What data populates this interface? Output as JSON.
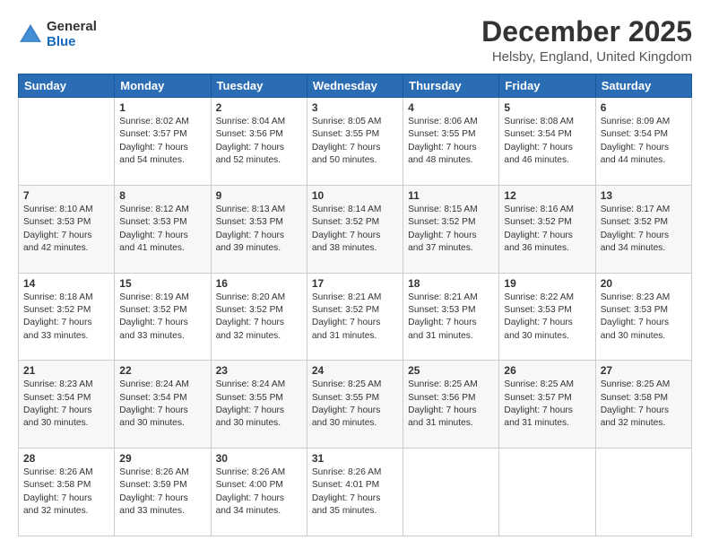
{
  "logo": {
    "general": "General",
    "blue": "Blue"
  },
  "title": "December 2025",
  "subtitle": "Helsby, England, United Kingdom",
  "days_of_week": [
    "Sunday",
    "Monday",
    "Tuesday",
    "Wednesday",
    "Thursday",
    "Friday",
    "Saturday"
  ],
  "weeks": [
    [
      {
        "day": "",
        "info": ""
      },
      {
        "day": "1",
        "info": "Sunrise: 8:02 AM\nSunset: 3:57 PM\nDaylight: 7 hours\nand 54 minutes."
      },
      {
        "day": "2",
        "info": "Sunrise: 8:04 AM\nSunset: 3:56 PM\nDaylight: 7 hours\nand 52 minutes."
      },
      {
        "day": "3",
        "info": "Sunrise: 8:05 AM\nSunset: 3:55 PM\nDaylight: 7 hours\nand 50 minutes."
      },
      {
        "day": "4",
        "info": "Sunrise: 8:06 AM\nSunset: 3:55 PM\nDaylight: 7 hours\nand 48 minutes."
      },
      {
        "day": "5",
        "info": "Sunrise: 8:08 AM\nSunset: 3:54 PM\nDaylight: 7 hours\nand 46 minutes."
      },
      {
        "day": "6",
        "info": "Sunrise: 8:09 AM\nSunset: 3:54 PM\nDaylight: 7 hours\nand 44 minutes."
      }
    ],
    [
      {
        "day": "7",
        "info": "Sunrise: 8:10 AM\nSunset: 3:53 PM\nDaylight: 7 hours\nand 42 minutes."
      },
      {
        "day": "8",
        "info": "Sunrise: 8:12 AM\nSunset: 3:53 PM\nDaylight: 7 hours\nand 41 minutes."
      },
      {
        "day": "9",
        "info": "Sunrise: 8:13 AM\nSunset: 3:53 PM\nDaylight: 7 hours\nand 39 minutes."
      },
      {
        "day": "10",
        "info": "Sunrise: 8:14 AM\nSunset: 3:52 PM\nDaylight: 7 hours\nand 38 minutes."
      },
      {
        "day": "11",
        "info": "Sunrise: 8:15 AM\nSunset: 3:52 PM\nDaylight: 7 hours\nand 37 minutes."
      },
      {
        "day": "12",
        "info": "Sunrise: 8:16 AM\nSunset: 3:52 PM\nDaylight: 7 hours\nand 36 minutes."
      },
      {
        "day": "13",
        "info": "Sunrise: 8:17 AM\nSunset: 3:52 PM\nDaylight: 7 hours\nand 34 minutes."
      }
    ],
    [
      {
        "day": "14",
        "info": "Sunrise: 8:18 AM\nSunset: 3:52 PM\nDaylight: 7 hours\nand 33 minutes."
      },
      {
        "day": "15",
        "info": "Sunrise: 8:19 AM\nSunset: 3:52 PM\nDaylight: 7 hours\nand 33 minutes."
      },
      {
        "day": "16",
        "info": "Sunrise: 8:20 AM\nSunset: 3:52 PM\nDaylight: 7 hours\nand 32 minutes."
      },
      {
        "day": "17",
        "info": "Sunrise: 8:21 AM\nSunset: 3:52 PM\nDaylight: 7 hours\nand 31 minutes."
      },
      {
        "day": "18",
        "info": "Sunrise: 8:21 AM\nSunset: 3:53 PM\nDaylight: 7 hours\nand 31 minutes."
      },
      {
        "day": "19",
        "info": "Sunrise: 8:22 AM\nSunset: 3:53 PM\nDaylight: 7 hours\nand 30 minutes."
      },
      {
        "day": "20",
        "info": "Sunrise: 8:23 AM\nSunset: 3:53 PM\nDaylight: 7 hours\nand 30 minutes."
      }
    ],
    [
      {
        "day": "21",
        "info": "Sunrise: 8:23 AM\nSunset: 3:54 PM\nDaylight: 7 hours\nand 30 minutes."
      },
      {
        "day": "22",
        "info": "Sunrise: 8:24 AM\nSunset: 3:54 PM\nDaylight: 7 hours\nand 30 minutes."
      },
      {
        "day": "23",
        "info": "Sunrise: 8:24 AM\nSunset: 3:55 PM\nDaylight: 7 hours\nand 30 minutes."
      },
      {
        "day": "24",
        "info": "Sunrise: 8:25 AM\nSunset: 3:55 PM\nDaylight: 7 hours\nand 30 minutes."
      },
      {
        "day": "25",
        "info": "Sunrise: 8:25 AM\nSunset: 3:56 PM\nDaylight: 7 hours\nand 31 minutes."
      },
      {
        "day": "26",
        "info": "Sunrise: 8:25 AM\nSunset: 3:57 PM\nDaylight: 7 hours\nand 31 minutes."
      },
      {
        "day": "27",
        "info": "Sunrise: 8:25 AM\nSunset: 3:58 PM\nDaylight: 7 hours\nand 32 minutes."
      }
    ],
    [
      {
        "day": "28",
        "info": "Sunrise: 8:26 AM\nSunset: 3:58 PM\nDaylight: 7 hours\nand 32 minutes."
      },
      {
        "day": "29",
        "info": "Sunrise: 8:26 AM\nSunset: 3:59 PM\nDaylight: 7 hours\nand 33 minutes."
      },
      {
        "day": "30",
        "info": "Sunrise: 8:26 AM\nSunset: 4:00 PM\nDaylight: 7 hours\nand 34 minutes."
      },
      {
        "day": "31",
        "info": "Sunrise: 8:26 AM\nSunset: 4:01 PM\nDaylight: 7 hours\nand 35 minutes."
      },
      {
        "day": "",
        "info": ""
      },
      {
        "day": "",
        "info": ""
      },
      {
        "day": "",
        "info": ""
      }
    ]
  ]
}
